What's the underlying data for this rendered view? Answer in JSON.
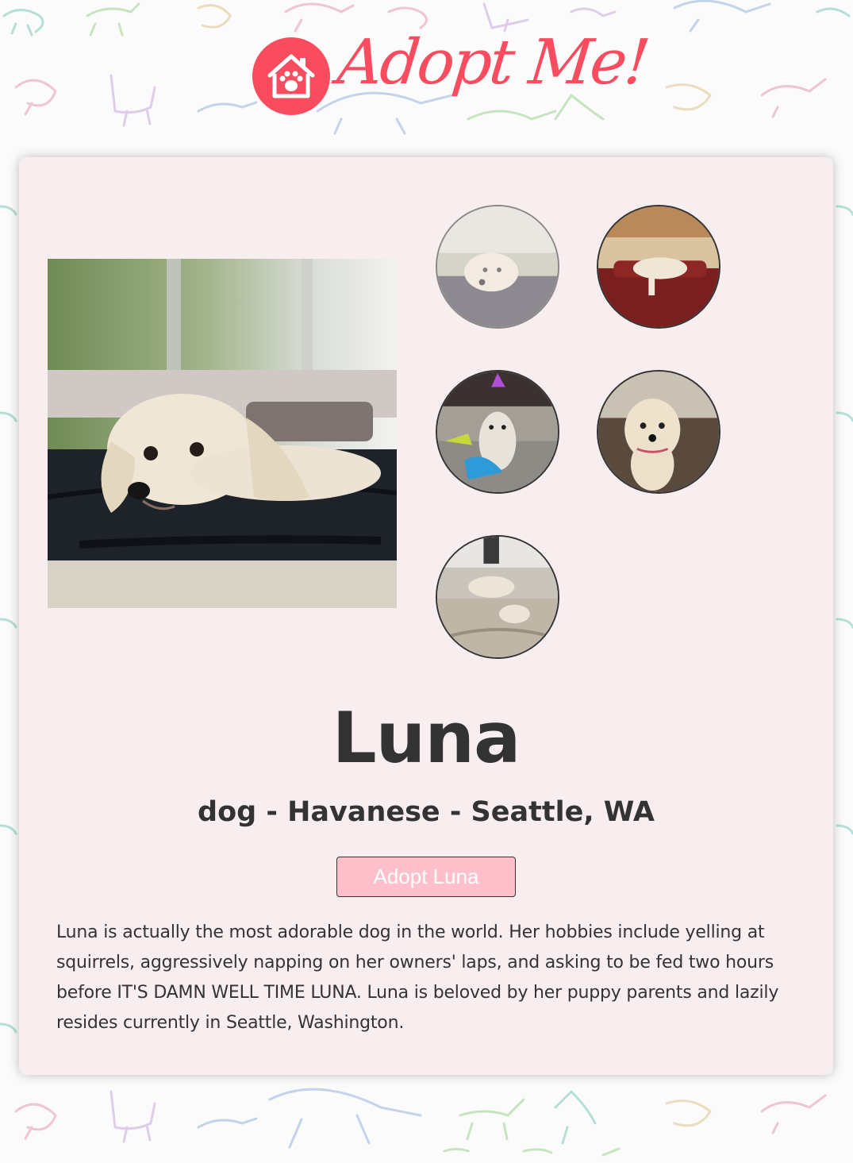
{
  "brand": {
    "logo_text": "Adopt Me!",
    "accent_color": "#f94c5e",
    "icon": "house-paw-icon"
  },
  "pet": {
    "name": "Luna",
    "meta": "dog - Havanese - Seattle, WA",
    "adopt_label": "Adopt Luna",
    "description": "Luna is actually the most adorable dog in the world. Her hobbies include yelling at squirrels, aggressively napping on her owners' laps, and asking to be fed two hours before IT'S DAMN WELL TIME LUNA. Luna is beloved by her puppy parents and lazily resides currently in Seattle, Washington."
  },
  "gallery": {
    "active_index": 0,
    "thumbs": [
      "photo-1",
      "photo-2",
      "photo-3",
      "photo-4",
      "photo-5"
    ]
  },
  "colors": {
    "card_bg": "#f8eef0",
    "button_bg": "#ffc0cb",
    "text": "#333333"
  }
}
